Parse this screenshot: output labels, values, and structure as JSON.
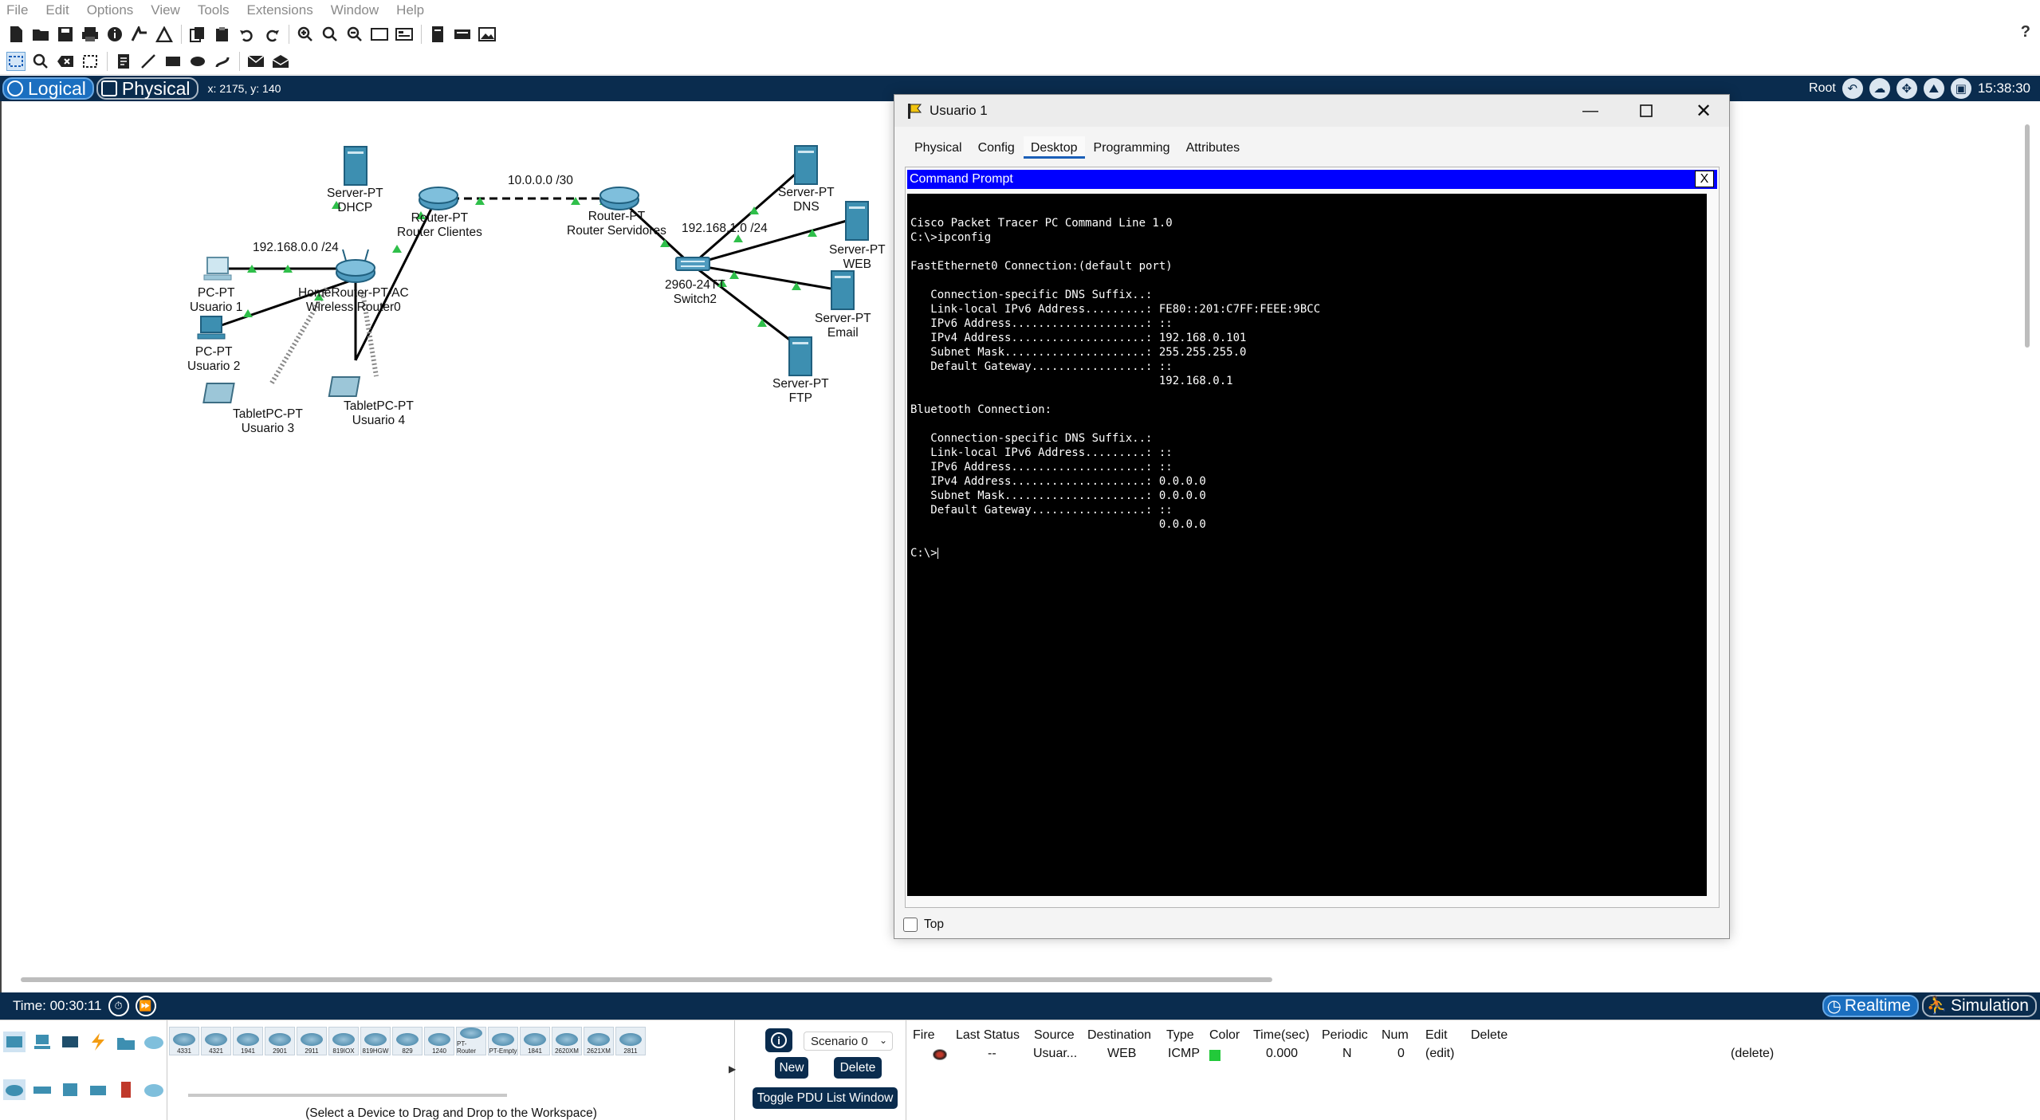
{
  "menu": [
    "File",
    "Edit",
    "Options",
    "View",
    "Tools",
    "Extensions",
    "Window",
    "Help"
  ],
  "toolbar_help": "?",
  "logical_bar": {
    "logical_label": "Logical",
    "physical_label": "Physical",
    "coord_text": "x: 2175, y: 140",
    "root_label": "Root",
    "clock": "15:38:30"
  },
  "network": {
    "devices": [
      {
        "type": "Server-PT",
        "name": "DHCP"
      },
      {
        "type": "Router-PT",
        "name": "Router Clientes"
      },
      {
        "type": "Router-PT",
        "name": "Router Servidores"
      },
      {
        "type": "HomeRouter-PT-AC",
        "name": "Wireless Router0"
      },
      {
        "type": "PC-PT",
        "name": "Usuario 1"
      },
      {
        "type": "PC-PT",
        "name": "Usuario 2"
      },
      {
        "type": "TabletPC-PT",
        "name": "Usuario 3"
      },
      {
        "type": "TabletPC-PT",
        "name": "Usuario 4"
      },
      {
        "type": "2960-24TT",
        "name": "Switch2"
      },
      {
        "type": "Server-PT",
        "name": "DNS"
      },
      {
        "type": "Server-PT",
        "name": "WEB"
      },
      {
        "type": "Server-PT",
        "name": "Email"
      },
      {
        "type": "Server-PT",
        "name": "FTP"
      }
    ],
    "subnets": [
      "10.0.0.0 /30",
      "192.168.0.0 /24",
      "192.168.1.0 /24"
    ]
  },
  "dialog": {
    "title": "Usuario 1",
    "tabs": [
      "Physical",
      "Config",
      "Desktop",
      "Programming",
      "Attributes"
    ],
    "active_tab": "Desktop",
    "cmd_title": "Command Prompt",
    "cmd_close": "X",
    "terminal_lines": [
      "Cisco Packet Tracer PC Command Line 1.0",
      "C:\\>ipconfig",
      "",
      "FastEthernet0 Connection:(default port)",
      "",
      "   Connection-specific DNS Suffix..: ",
      "   Link-local IPv6 Address.........: FE80::201:C7FF:FEEE:9BCC",
      "   IPv6 Address....................: ::",
      "   IPv4 Address....................: 192.168.0.101",
      "   Subnet Mask.....................: 255.255.255.0",
      "   Default Gateway.................: ::",
      "                                     192.168.0.1",
      "",
      "Bluetooth Connection:",
      "",
      "   Connection-specific DNS Suffix..: ",
      "   Link-local IPv6 Address.........: ::",
      "   IPv6 Address....................: ::",
      "   IPv4 Address....................: 0.0.0.0",
      "   Subnet Mask.....................: 0.0.0.0",
      "   Default Gateway.................: ::",
      "                                     0.0.0.0",
      "",
      "C:\\>"
    ],
    "top_label": "Top"
  },
  "statusbar": {
    "time": "Time: 00:30:11",
    "realtime_label": "Realtime",
    "simulation_label": "Simulation"
  },
  "bottom": {
    "device_models": [
      "4331",
      "4321",
      "1941",
      "2901",
      "2911",
      "819IOX",
      "819HGW",
      "829",
      "1240",
      "PT-Router",
      "PT-Empty",
      "1841",
      "2620XM",
      "2621XM",
      "2811"
    ],
    "select_hint": "(Select a Device to Drag and Drop to the Workspace)",
    "scenario": "Scenario 0",
    "new_label": "New",
    "delete_label": "Delete",
    "toggle_label": "Toggle PDU List Window",
    "pdu_headers": [
      "Fire",
      "Last Status",
      "Source",
      "Destination",
      "Type",
      "Color",
      "Time(sec)",
      "Periodic",
      "Num",
      "Edit",
      "Delete"
    ],
    "pdu_rows": [
      {
        "last_status": "--",
        "source": "Usuar...",
        "destination": "WEB",
        "type": "ICMP",
        "color": "#22c93a",
        "time": "0.000",
        "periodic": "N",
        "num": "0",
        "edit": "(edit)",
        "delete": "(delete)"
      }
    ]
  },
  "colors": {
    "dark_bar": "#0a2c4e",
    "accent": "#1b6fc0",
    "cmd_header": "#0000ff"
  }
}
